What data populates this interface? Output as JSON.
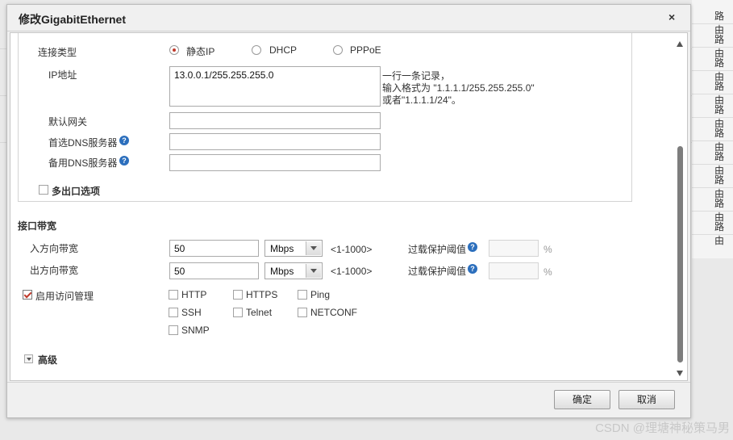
{
  "background": {
    "right_items": [
      "路由",
      "路由",
      "路由",
      "路由",
      "路由",
      "路由",
      "路由",
      "路由",
      "路由",
      "路由"
    ]
  },
  "dialog": {
    "title": "修改GigabitEthernet",
    "close": "×",
    "connection": {
      "label": "连接类型",
      "options": [
        {
          "label": "静态IP",
          "selected": true
        },
        {
          "label": "DHCP",
          "selected": false
        },
        {
          "label": "PPPoE",
          "selected": false
        }
      ]
    },
    "ip": {
      "label": "IP地址",
      "value": "13.0.0.1/255.255.255.0",
      "hint_lines": [
        "一行一条记录，",
        "输入格式为 \"1.1.1.1/255.255.255.0\"",
        "或者\"1.1.1.1/24\"。"
      ]
    },
    "gateway": {
      "label": "默认网关",
      "value": ""
    },
    "dns1": {
      "label": "首选DNS服务器",
      "value": ""
    },
    "dns2": {
      "label": "备用DNS服务器",
      "value": ""
    },
    "multi_exit": {
      "label": "多出口选项",
      "checked": false
    },
    "bandwidth": {
      "title": "接口带宽",
      "inbound": {
        "label": "入方向带宽",
        "value": "50",
        "unit": "Mbps",
        "range": "<1-1000>",
        "protect_label": "过载保护阈值",
        "protect_value": "",
        "percent": "%"
      },
      "outbound": {
        "label": "出方向带宽",
        "value": "50",
        "unit": "Mbps",
        "range": "<1-1000>",
        "protect_label": "过载保护阈值",
        "protect_value": "",
        "percent": "%"
      }
    },
    "access": {
      "label": "启用访问管理",
      "checked": true,
      "options": [
        {
          "label": "HTTP",
          "checked": false
        },
        {
          "label": "HTTPS",
          "checked": false
        },
        {
          "label": "Ping",
          "checked": false
        },
        {
          "label": "SSH",
          "checked": false
        },
        {
          "label": "Telnet",
          "checked": false
        },
        {
          "label": "NETCONF",
          "checked": false
        },
        {
          "label": "SNMP",
          "checked": false
        }
      ]
    },
    "advanced": {
      "label": "高级"
    },
    "ok_label": "确定",
    "cancel_label": "取消"
  },
  "watermark": "CSDN @理塘神秘策马男",
  "colors": {
    "accent": "#c0392b",
    "help": "#2c6fbd"
  }
}
